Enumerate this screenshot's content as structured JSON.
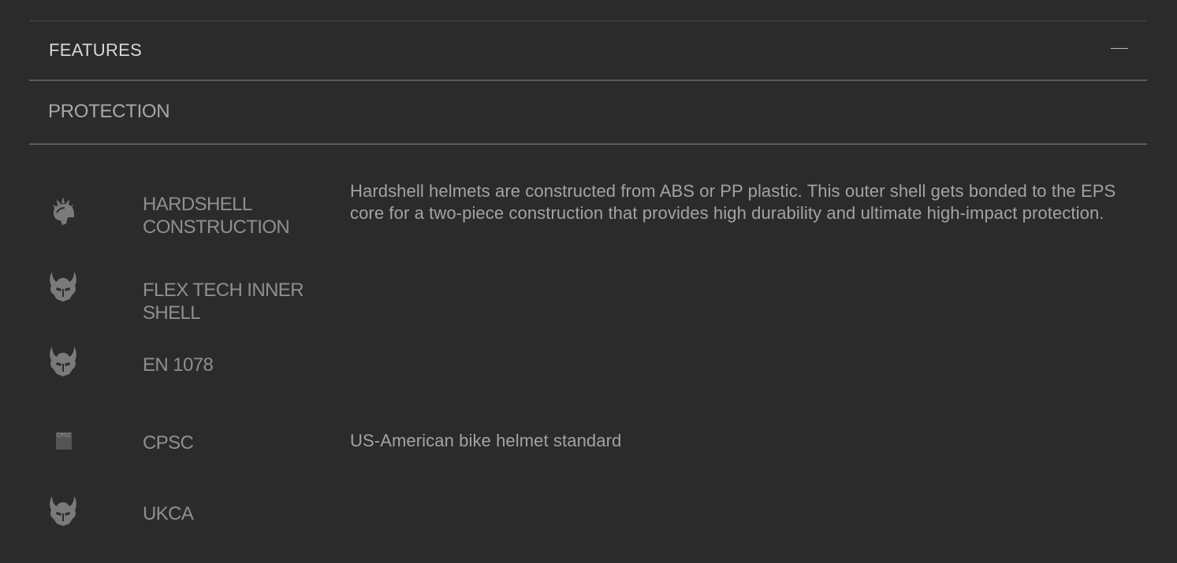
{
  "accordion": {
    "title": "FEATURES",
    "collapse_icon": "minus-icon"
  },
  "section": {
    "title": "PROTECTION"
  },
  "features": [
    {
      "name": "HARDSHELL CONSTRUCTION",
      "icon": "spiked-helmet-icon",
      "description": "Hardshell helmets are constructed from ABS or PP plastic. This outer shell gets bonded to the EPS core for a two-piece construction that provides high durability and ultimate high-impact protection."
    },
    {
      "name": "FLEX TECH INNER SHELL",
      "icon": "viking-helmet-icon",
      "description": ""
    },
    {
      "name": "EN 1078",
      "icon": "viking-helmet-icon",
      "description": ""
    },
    {
      "name": "CPSC",
      "icon": "cpsc-badge-icon",
      "badge_text": "CPSC",
      "description": "US-American bike helmet standard"
    },
    {
      "name": "UKCA",
      "icon": "viking-helmet-icon",
      "description": ""
    }
  ],
  "colors": {
    "background": "#2b2b2b",
    "divider": "#5c5c5c",
    "icon": "#7a7a7a",
    "feature_name": "#8f8f8f",
    "description": "#a3a3a3"
  }
}
